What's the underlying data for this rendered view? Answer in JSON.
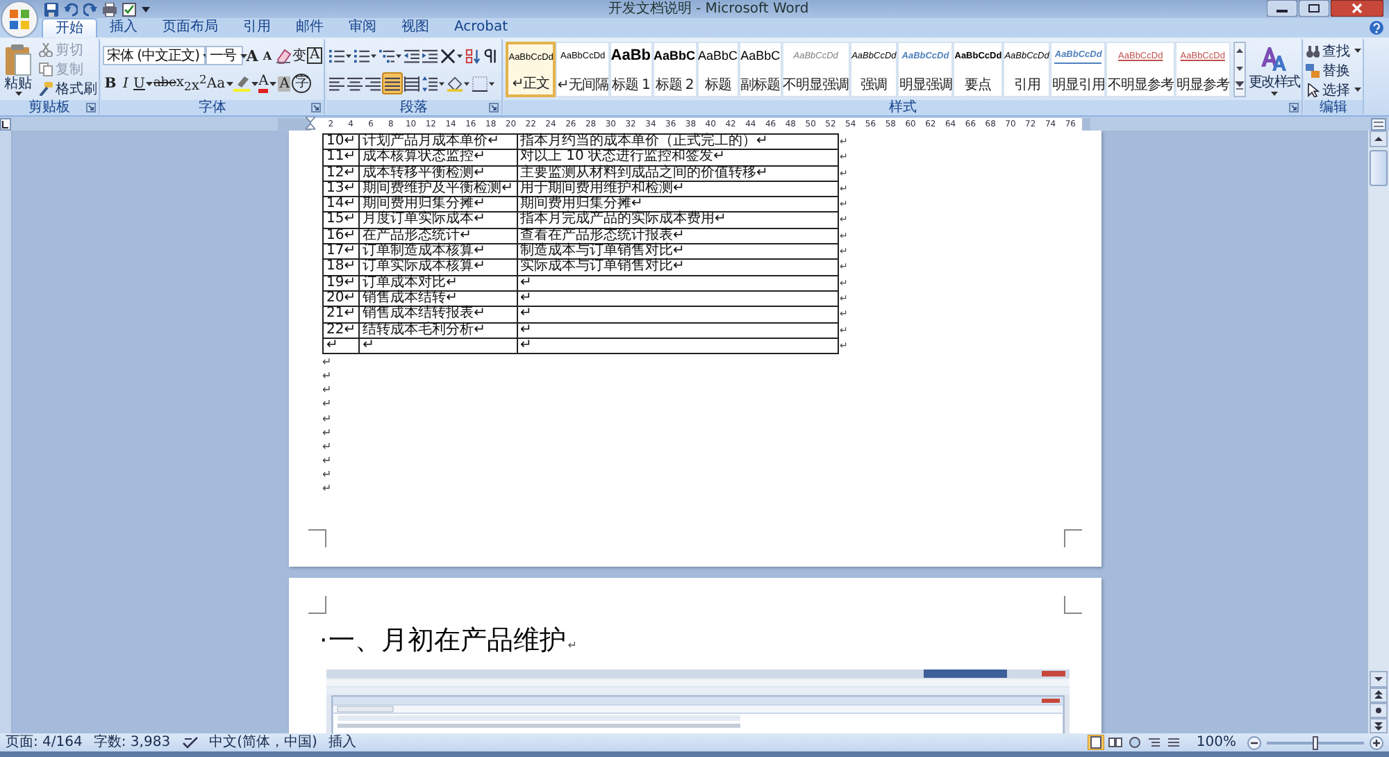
{
  "window": {
    "title": "开发文档说明 - Microsoft Word"
  },
  "tabs": [
    {
      "label": "开始",
      "selected": true
    },
    {
      "label": "插入",
      "selected": false
    },
    {
      "label": "页面布局",
      "selected": false
    },
    {
      "label": "引用",
      "selected": false
    },
    {
      "label": "邮件",
      "selected": false
    },
    {
      "label": "审阅",
      "selected": false
    },
    {
      "label": "视图",
      "selected": false
    },
    {
      "label": "Acrobat",
      "selected": false
    }
  ],
  "clipboard": {
    "label": "剪贴板",
    "paste": "粘贴",
    "items": [
      {
        "kind": "cut",
        "label": "剪切",
        "disabled": true
      },
      {
        "kind": "copy",
        "label": "复制",
        "disabled": true
      },
      {
        "kind": "painter",
        "label": "格式刷",
        "disabled": false
      }
    ]
  },
  "font": {
    "label": "字体",
    "font_name": "宋体 (中文正文)",
    "font_size": "一号",
    "row1": [
      {
        "kind": "grow",
        "text": "A"
      },
      {
        "kind": "shrink",
        "text": "A"
      },
      {
        "kind": "clear"
      },
      {
        "kind": "phonetic",
        "text": "变"
      },
      {
        "kind": "border",
        "text": "A"
      }
    ],
    "row2": [
      {
        "kind": "bold",
        "text": "B"
      },
      {
        "kind": "italic",
        "text": "I"
      },
      {
        "kind": "underline",
        "text": "U"
      },
      {
        "kind": "strike",
        "text": "abe"
      },
      {
        "kind": "sub",
        "text": "x$_{2}$"
      },
      {
        "kind": "sup",
        "text": "x$^{2}$"
      },
      {
        "kind": "case",
        "text": "Aa"
      },
      {
        "kind": "highlight"
      },
      {
        "kind": "color",
        "text": "A"
      },
      {
        "kind": "shading",
        "text": "A"
      },
      {
        "kind": "enclose",
        "text": "字"
      }
    ]
  },
  "paragraph": {
    "label": "段落",
    "row1": [
      {
        "kind": "bullets"
      },
      {
        "kind": "numbering"
      },
      {
        "kind": "multilevel"
      },
      {
        "kind": "outdent"
      },
      {
        "kind": "indent"
      },
      {
        "kind": "asian"
      },
      {
        "kind": "sort"
      },
      {
        "kind": "marks"
      }
    ],
    "alignment": [
      {
        "kind": "left",
        "selected": false
      },
      {
        "kind": "center",
        "selected": false
      },
      {
        "kind": "right",
        "selected": false
      },
      {
        "kind": "justify",
        "selected": true
      },
      {
        "kind": "distribute",
        "selected": false
      }
    ],
    "row2_more": [
      {
        "kind": "spacing"
      },
      {
        "kind": "shading"
      },
      {
        "kind": "borders"
      }
    ]
  },
  "styles": {
    "label": "样式",
    "change": "更改样式",
    "items": [
      {
        "preview": "AaBbCcDd",
        "label": "↵正文",
        "kind": "normal",
        "selected": true
      },
      {
        "preview": "AaBbCcDd",
        "label": "↵无间隔",
        "kind": "normal",
        "selected": false
      },
      {
        "preview": "AaBb",
        "label": "标题 1",
        "kind": "h1",
        "selected": false
      },
      {
        "preview": "AaBbC",
        "label": "标题 2",
        "kind": "h2",
        "selected": false
      },
      {
        "preview": "AaBbC",
        "label": "标题",
        "kind": "title",
        "selected": false
      },
      {
        "preview": "AaBbC",
        "label": "副标题",
        "kind": "title",
        "selected": false
      },
      {
        "preview": "AaBbCcDd",
        "label": "不明显强调",
        "kind": "subtle",
        "selected": false
      },
      {
        "preview": "AaBbCcDd",
        "label": "强调",
        "kind": "emphasis",
        "selected": false
      },
      {
        "preview": "AaBbCcDd",
        "label": "明显强调",
        "kind": "intense",
        "selected": false
      },
      {
        "preview": "AaBbCcDd",
        "label": "要点",
        "kind": "strong",
        "selected": false
      },
      {
        "preview": "AaBbCcDd",
        "label": "引用",
        "kind": "emphasis",
        "selected": false
      },
      {
        "preview": "AaBbCcDd",
        "label": "明显引用",
        "kind": "quote",
        "selected": false
      },
      {
        "preview": "AaBbCcDd",
        "label": "不明显参考",
        "kind": "reference",
        "selected": false
      },
      {
        "preview": "AaBbCcDd",
        "label": "明显参考",
        "kind": "reference",
        "selected": false
      }
    ]
  },
  "editing": {
    "label": "编辑",
    "items": [
      {
        "kind": "find",
        "label": "查找"
      },
      {
        "kind": "replace",
        "label": "替换"
      },
      {
        "kind": "select",
        "label": "选择"
      }
    ]
  },
  "ruler": {
    "numbers": [
      "2",
      "4",
      "6",
      "8",
      "10",
      "12",
      "14",
      "16",
      "18",
      "20",
      "22",
      "24",
      "26",
      "28",
      "30",
      "32",
      "34",
      "36",
      "38",
      "40",
      "42",
      "44",
      "46",
      "48",
      "50",
      "52",
      "54",
      "56",
      "58",
      "60",
      "62",
      "64",
      "66",
      "68",
      "70",
      "72",
      "74",
      "76"
    ]
  },
  "document": {
    "table": {
      "rows": [
        {
          "cells": [
            "10↵",
            "计划产品月成本单价↵",
            "指本月约当的成本单价（正式完工的）↵"
          ],
          "end_mark": "↵"
        },
        {
          "cells": [
            "11↵",
            "成本核算状态监控↵",
            "对以上 10 状态进行监控和签发↵"
          ],
          "end_mark": "↵"
        },
        {
          "cells": [
            "12↵",
            "成本转移平衡检测↵",
            "主要监测从材料到成品之间的价值转移↵"
          ],
          "end_mark": "↵"
        },
        {
          "cells": [
            "13↵",
            "期间费维护及平衡检测↵",
            "用于期间费用维护和检测↵"
          ],
          "end_mark": "↵"
        },
        {
          "cells": [
            "14↵",
            "期间费用归集分摊↵",
            "期间费用归集分摊↵"
          ],
          "end_mark": "↵"
        },
        {
          "cells": [
            "15↵",
            "月度订单实际成本↵",
            "指本月完成产品的实际成本费用↵"
          ],
          "end_mark": "↵"
        },
        {
          "cells": [
            "16↵",
            "在产品形态统计↵",
            "查看在产品形态统计报表↵"
          ],
          "end_mark": "↵"
        },
        {
          "cells": [
            "17↵",
            "订单制造成本核算↵",
            "制造成本与订单销售对比↵"
          ],
          "end_mark": "↵"
        },
        {
          "cells": [
            "18↵",
            "订单实际成本核算↵",
            "实际成本与订单销售对比↵"
          ],
          "end_mark": "↵"
        },
        {
          "cells": [
            "19↵",
            "订单成本对比↵",
            "↵"
          ],
          "end_mark": "↵"
        },
        {
          "cells": [
            "20↵",
            "销售成本结转↵",
            "↵"
          ],
          "end_mark": "↵"
        },
        {
          "cells": [
            "21↵",
            "销售成本结转报表↵",
            "↵"
          ],
          "end_mark": "↵"
        },
        {
          "cells": [
            "22↵",
            "结转成本毛利分析↵",
            "↵"
          ],
          "end_mark": "↵"
        },
        {
          "cells": [
            "↵",
            "↵",
            "↵"
          ],
          "end_mark": "↵"
        }
      ]
    },
    "paragraph_marks": [
      "↵",
      "↵",
      "↵",
      "↵",
      "↵",
      "↵",
      "↵",
      "↵",
      "↵",
      "↵"
    ],
    "heading": {
      "bullet": "·",
      "text": "一、月初在产品维护",
      "mark": "↵"
    }
  },
  "status_bar": {
    "items": [
      "页面: 4/164",
      "字数: 3,983"
    ],
    "language": "中文(简体，中国)",
    "mode": "插入",
    "views": [
      {
        "kind": "print",
        "selected": true
      },
      {
        "kind": "read",
        "selected": false
      },
      {
        "kind": "web",
        "selected": false
      },
      {
        "kind": "outline",
        "selected": false
      },
      {
        "kind": "draft",
        "selected": false
      }
    ],
    "zoom": "100%",
    "zoom_slider": {
      "level": 0.5
    }
  }
}
